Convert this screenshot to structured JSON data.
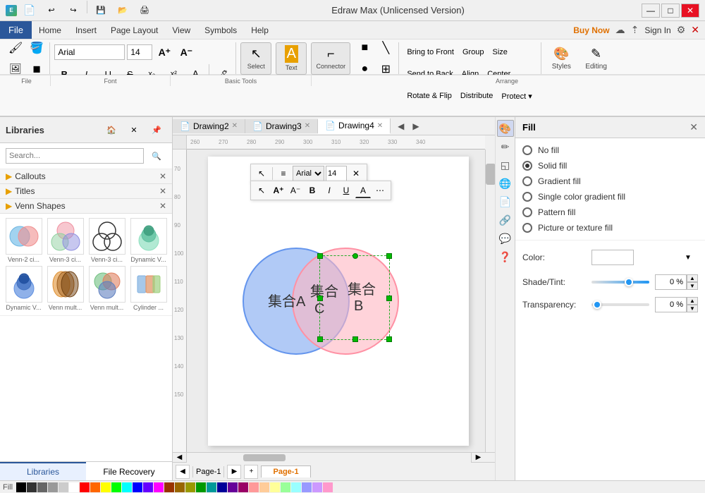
{
  "titlebar": {
    "title": "Edraw Max (Unlicensed Version)",
    "min_btn": "—",
    "max_btn": "□",
    "close_btn": "✕"
  },
  "menubar": {
    "items": [
      "File",
      "Home",
      "Insert",
      "Page Layout",
      "View",
      "Symbols",
      "Help"
    ],
    "right": {
      "buy_now": "Buy Now",
      "sign_in": "Sign In"
    }
  },
  "toolbar": {
    "font_name": "Arial",
    "font_size": "14",
    "select_label": "Select",
    "text_label": "Text",
    "connector_label": "Connector",
    "basic_tools_label": "Basic Tools",
    "arrange_label": "Arrange",
    "font_label": "Font",
    "file_label": "File",
    "bring_front": "Bring to Front",
    "send_back": "Send to Back",
    "rotate_flip": "Rotate & Flip",
    "group": "Group",
    "align": "Align",
    "distribute": "Distribute",
    "size": "Size",
    "center": "Center",
    "protect": "Protect ▾",
    "styles_label": "Styles",
    "editing_label": "Editing"
  },
  "sidebar": {
    "title": "Libraries",
    "search_placeholder": "Search...",
    "categories": [
      {
        "label": "Callouts",
        "color": "#e8a000"
      },
      {
        "label": "Titles",
        "color": "#e8a000"
      },
      {
        "label": "Venn Shapes",
        "color": "#e8a000"
      }
    ],
    "shapes": [
      {
        "label": "Venn-2 ci...",
        "type": "venn2",
        "colors": [
          "#6eb5e0",
          "#f09090"
        ]
      },
      {
        "label": "Venn-3 ci...",
        "type": "venn3",
        "colors": [
          "#f090a0",
          "#90d0a0",
          "#9090e0"
        ]
      },
      {
        "label": "Venn-3 ci...",
        "type": "venn3b",
        "colors": [
          "#333",
          "#333",
          "#333"
        ]
      },
      {
        "label": "Dynamic V...",
        "type": "dynamic1",
        "colors": [
          "#90e0c0",
          "#60c0a0",
          "#40a080"
        ]
      },
      {
        "label": "Dynamic V...",
        "type": "dynamic2",
        "colors": [
          "#6090e0",
          "#4070c0",
          "#2050a0"
        ]
      },
      {
        "label": "Venn mult...",
        "type": "venn_mult",
        "colors": [
          "#e09030",
          "#a06020",
          "#704010"
        ]
      },
      {
        "label": "Venn mult...",
        "type": "venn_mult2",
        "colors": [
          "#70c080",
          "#e08060",
          "#6080c0"
        ]
      },
      {
        "label": "Cylinder ...",
        "type": "cylinder",
        "colors": [
          "#80b0e0",
          "#e09060",
          "#a0d080"
        ]
      }
    ],
    "tabs": [
      {
        "label": "Libraries",
        "active": true
      },
      {
        "label": "File Recovery",
        "active": false
      }
    ]
  },
  "tabs": [
    {
      "label": "Drawing2",
      "active": false
    },
    {
      "label": "Drawing3",
      "active": false
    },
    {
      "label": "Drawing4",
      "active": true
    }
  ],
  "canvas": {
    "venn": {
      "label_a": "集合A",
      "label_b": "集合B",
      "label_c": "集合C"
    },
    "float_toolbar": {
      "font": "Arial",
      "size": "14"
    }
  },
  "fill_panel": {
    "title": "Fill",
    "options": [
      {
        "label": "No fill",
        "checked": false
      },
      {
        "label": "Solid fill",
        "checked": true
      },
      {
        "label": "Gradient fill",
        "checked": false
      },
      {
        "label": "Single color gradient fill",
        "checked": false
      },
      {
        "label": "Pattern fill",
        "checked": false
      },
      {
        "label": "Picture or texture fill",
        "checked": false
      }
    ],
    "color_label": "Color:",
    "shade_label": "Shade/Tint:",
    "shade_value": "0 %",
    "transparency_label": "Transparency:",
    "transparency_value": "0 %"
  },
  "page_nav": {
    "prev": "◀",
    "next": "▶",
    "add": "+",
    "page_name": "Page-1",
    "active_tab": "Page-1"
  },
  "colors": [
    "#000000",
    "#333333",
    "#666666",
    "#999999",
    "#cccccc",
    "#ffffff",
    "#ff0000",
    "#ff6600",
    "#ffff00",
    "#00ff00",
    "#00ffff",
    "#0000ff",
    "#6600ff",
    "#ff00ff",
    "#993300",
    "#996600",
    "#999900",
    "#009900",
    "#009999",
    "#000099",
    "#660099",
    "#990066",
    "#ff9999",
    "#ffcc99",
    "#ffff99",
    "#99ff99",
    "#99ffff",
    "#9999ff",
    "#cc99ff",
    "#ff99cc"
  ]
}
